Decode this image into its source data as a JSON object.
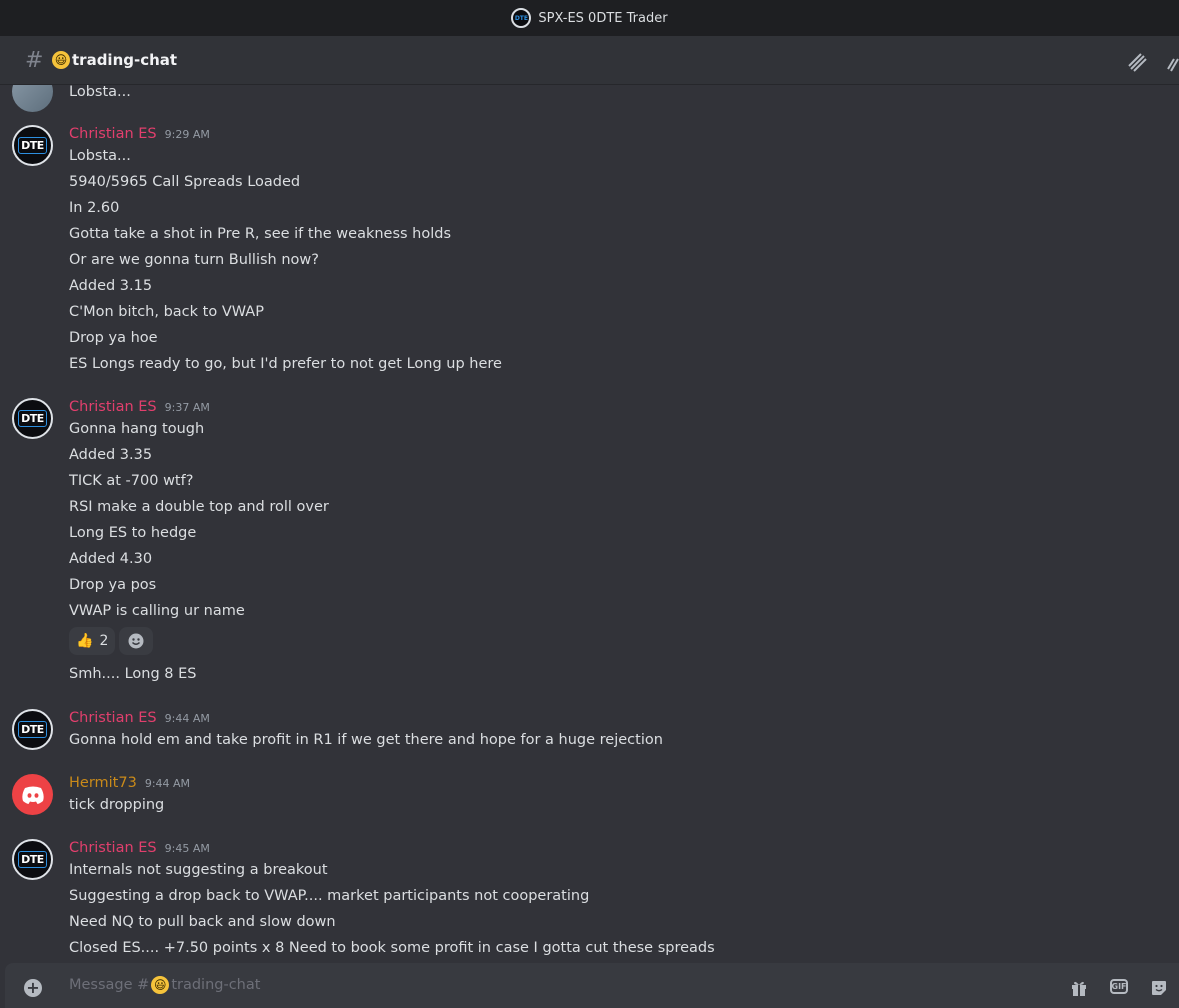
{
  "window": {
    "title": "SPX-ES 0DTE Trader",
    "logo_text": "DTE"
  },
  "channel": {
    "name": "trading-chat",
    "emoji": "😃",
    "prefix": "#"
  },
  "colors": {
    "christian": "#e23f6d",
    "hermit": "#c98a1a"
  },
  "groups": [
    {
      "author": "",
      "time": "",
      "avatar": "partial",
      "lines": [
        "Lobsta..."
      ]
    },
    {
      "author": "Christian ES",
      "time": "9:29 AM",
      "avatar": "dte",
      "lines": [
        "Lobsta...",
        "5940/5965 Call Spreads Loaded",
        "In 2.60",
        "Gotta take a shot in Pre R, see if the weakness holds",
        "Or are we gonna turn Bullish now?",
        "Added 3.15",
        "C'Mon bitch, back to VWAP",
        "Drop ya hoe",
        "ES Longs ready to go, but I'd prefer to not get Long up here"
      ]
    },
    {
      "author": "Christian ES",
      "time": "9:37 AM",
      "avatar": "dte",
      "lines": [
        "Gonna hang tough",
        "Added 3.35",
        "TICK at -700  wtf?",
        "RSI make a double top and roll over",
        "Long ES to hedge",
        "Added 4.30",
        "Drop ya pos",
        "VWAP is calling ur name"
      ],
      "reaction": {
        "emoji": "👍",
        "count": "2"
      },
      "after_reaction": "Smh.... Long 8 ES"
    },
    {
      "author": "Christian ES",
      "time": "9:44 AM",
      "avatar": "dte",
      "lines": [
        "Gonna hold em and take profit in R1 if we get there and hope for a huge rejection"
      ]
    },
    {
      "author": "Hermit73",
      "time": "9:44 AM",
      "avatar": "discord",
      "lines": [
        "tick dropping"
      ]
    },
    {
      "author": "Christian ES",
      "time": "9:45 AM",
      "avatar": "dte",
      "lines": [
        "Internals not suggesting a breakout",
        "Suggesting a drop back to VWAP.... market participants not cooperating",
        "Need NQ to pull back and slow down",
        "Closed ES.... +7.50 points x 8     Need to book some profit in case I gotta cut these spreads"
      ]
    }
  ],
  "composer": {
    "placeholder_prefix": "Message #",
    "channel": "trading-chat",
    "gif_label": "GIF"
  },
  "icons": {
    "threads": "threads-icon",
    "pin": "pin-icon",
    "gift": "gift-icon",
    "gif": "gif-icon",
    "sticker": "sticker-icon",
    "add": "plus-icon",
    "react": "add-reaction-icon"
  }
}
